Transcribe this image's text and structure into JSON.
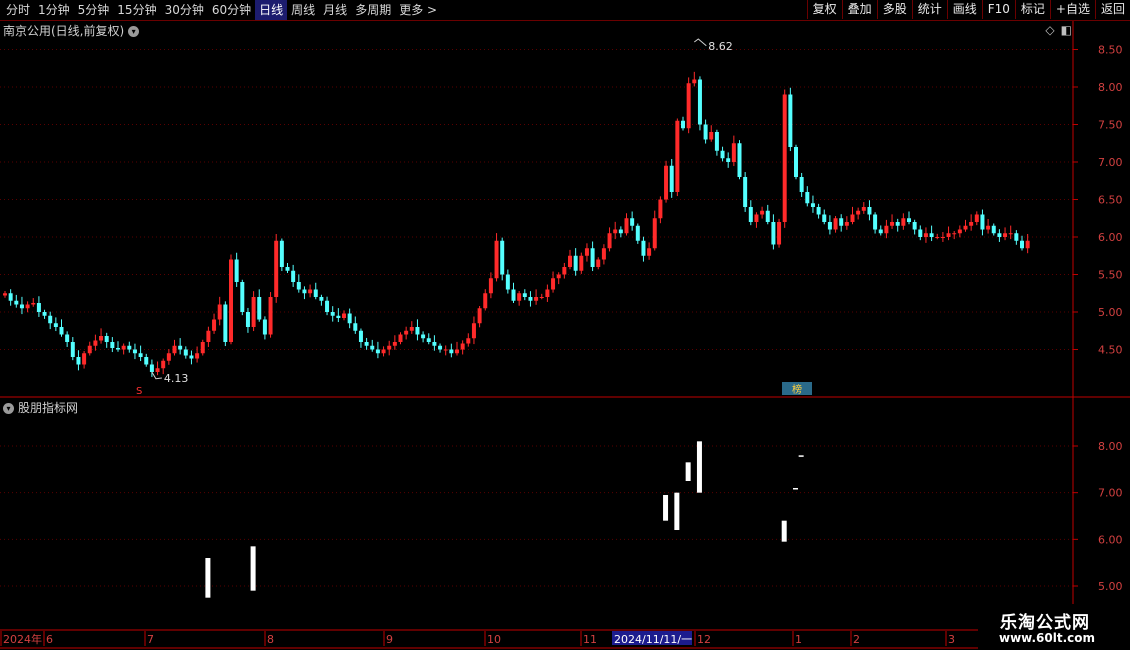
{
  "toolbar": {
    "periods": [
      "分时",
      "1分钟",
      "5分钟",
      "15分钟",
      "30分钟",
      "60分钟",
      "日线",
      "周线",
      "月线",
      "多周期",
      "更多 >"
    ],
    "active_period": "日线",
    "right_buttons": [
      "复权",
      "叠加",
      "多股",
      "统计",
      "画线",
      "F10",
      "标记",
      "+自选",
      "返回"
    ]
  },
  "main": {
    "title": "南京公用(日线,前复权)",
    "high_label": "8.62",
    "low_label": "4.13",
    "price_ticks": [
      "8.50",
      "8.00",
      "7.50",
      "7.00",
      "6.50",
      "6.00",
      "5.50",
      "5.00",
      "4.50"
    ],
    "marker_s": "S",
    "badge": "榜"
  },
  "indicator": {
    "title": "股朋指标网",
    "ticks": [
      "8.00",
      "7.00",
      "6.00",
      "5.00"
    ]
  },
  "xaxis": {
    "labels": [
      "2024年",
      "6",
      "7",
      "8",
      "9",
      "10",
      "11",
      "12",
      "1",
      "2",
      "3"
    ],
    "cursor_date": "2024/11/11/一"
  },
  "watermark": {
    "title": "乐淘公式网",
    "url": "www.60lt.com"
  },
  "colors": {
    "up": "#ff2a2a",
    "down": "#54ffff",
    "grid": "#5a0000",
    "axis": "#c00000",
    "tick_text": "#d24040"
  },
  "chart_data": {
    "type": "candlestick",
    "yrange": [
      4.0,
      8.7
    ],
    "closes": [
      5.25,
      5.15,
      5.1,
      5.05,
      5.1,
      5.12,
      5.0,
      4.95,
      4.85,
      4.8,
      4.7,
      4.6,
      4.4,
      4.3,
      4.45,
      4.55,
      4.62,
      4.68,
      4.6,
      4.52,
      4.5,
      4.55,
      4.5,
      4.45,
      4.4,
      4.3,
      4.2,
      4.25,
      4.35,
      4.45,
      4.55,
      4.5,
      4.42,
      4.38,
      4.45,
      4.6,
      4.75,
      4.9,
      5.1,
      4.6,
      5.7,
      5.4,
      5.0,
      4.8,
      5.2,
      4.9,
      4.7,
      5.2,
      5.95,
      5.6,
      5.55,
      5.4,
      5.3,
      5.25,
      5.3,
      5.2,
      5.15,
      5.0,
      4.95,
      4.92,
      4.98,
      4.85,
      4.75,
      4.6,
      4.55,
      4.5,
      4.45,
      4.5,
      4.55,
      4.6,
      4.7,
      4.75,
      4.8,
      4.7,
      4.65,
      4.6,
      4.55,
      4.5,
      4.5,
      4.45,
      4.5,
      4.58,
      4.65,
      4.85,
      5.05,
      5.25,
      5.45,
      5.95,
      5.5,
      5.3,
      5.15,
      5.25,
      5.2,
      5.15,
      5.2,
      5.2,
      5.3,
      5.45,
      5.5,
      5.6,
      5.75,
      5.55,
      5.75,
      5.85,
      5.6,
      5.7,
      5.85,
      6.05,
      6.1,
      6.05,
      6.25,
      6.15,
      5.95,
      5.75,
      5.85,
      6.25,
      6.5,
      6.95,
      6.6,
      7.55,
      7.45,
      8.05,
      8.1,
      7.5,
      7.3,
      7.4,
      7.15,
      7.05,
      7.0,
      7.25,
      6.8,
      6.4,
      6.2,
      6.3,
      6.35,
      6.2,
      5.9,
      6.2,
      7.9,
      7.2,
      6.8,
      6.6,
      6.45,
      6.4,
      6.3,
      6.2,
      6.1,
      6.25,
      6.15,
      6.2,
      6.3,
      6.35,
      6.4,
      6.3,
      6.1,
      6.05,
      6.15,
      6.2,
      6.15,
      6.25,
      6.2,
      6.1,
      6.0,
      6.05,
      6.0,
      6.0,
      6.0,
      6.05,
      6.05,
      6.1,
      6.15,
      6.2,
      6.3,
      6.1,
      6.15,
      6.05,
      6.0,
      6.05,
      6.05,
      5.95,
      5.85,
      5.95
    ],
    "indicator_boxes": [
      {
        "high": 5.6,
        "low": 4.75
      },
      {
        "high": 5.85,
        "low": 4.9
      },
      {
        "high": 7.65,
        "low": 7.25
      },
      {
        "high": 6.95,
        "low": 6.4
      },
      {
        "high": 7.0,
        "low": 6.2
      },
      {
        "high": 8.1,
        "low": 7.0
      },
      {
        "high": 7.8,
        "low": 7.78
      },
      {
        "high": 7.1,
        "low": 7.08
      },
      {
        "high": 6.4,
        "low": 5.95
      }
    ]
  }
}
